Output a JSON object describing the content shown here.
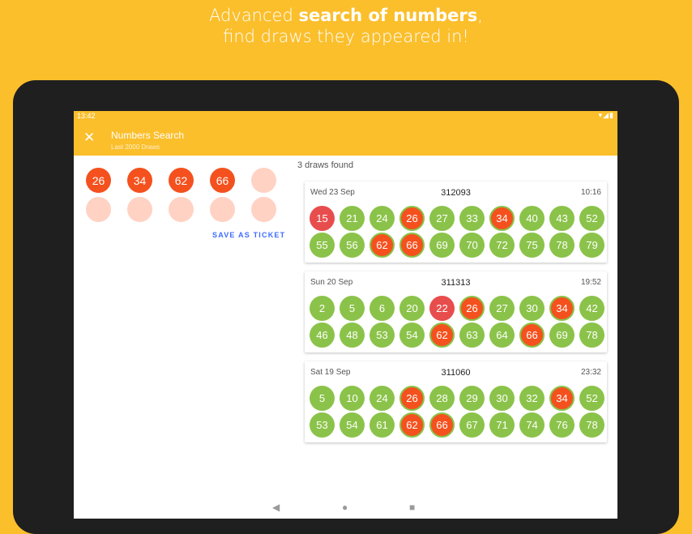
{
  "promo": {
    "line1_prefix": "Advanced ",
    "line1_bold": "search of numbers",
    "line1_suffix": ",",
    "line2": "find draws they appeared in!"
  },
  "status_bar": {
    "time": "13:42",
    "icons": "wifi-icon signal-icon battery-icon"
  },
  "app_bar": {
    "title": "Numbers Search",
    "subtitle": "Last 2000 Draws",
    "close_icon": "close-icon"
  },
  "selection": {
    "numbers": [
      "26",
      "34",
      "62",
      "66"
    ],
    "empty_slots": 6,
    "save_label": "SAVE AS TICKET"
  },
  "results": {
    "found_label": "3 draws found",
    "draws": [
      {
        "date": "Wed 23 Sep",
        "number": "312093",
        "time": "10:16",
        "rows": [
          [
            [
              "15",
              "red"
            ],
            [
              "21",
              "green"
            ],
            [
              "24",
              "green"
            ],
            [
              "26",
              "match"
            ],
            [
              "27",
              "green"
            ],
            [
              "33",
              "green"
            ],
            [
              "34",
              "match"
            ],
            [
              "40",
              "green"
            ],
            [
              "43",
              "green"
            ],
            [
              "52",
              "green"
            ]
          ],
          [
            [
              "55",
              "green"
            ],
            [
              "56",
              "green"
            ],
            [
              "62",
              "match"
            ],
            [
              "66",
              "match"
            ],
            [
              "69",
              "green"
            ],
            [
              "70",
              "green"
            ],
            [
              "72",
              "green"
            ],
            [
              "75",
              "green"
            ],
            [
              "78",
              "green"
            ],
            [
              "79",
              "green"
            ]
          ]
        ]
      },
      {
        "date": "Sun 20 Sep",
        "number": "311313",
        "time": "19:52",
        "rows": [
          [
            [
              "2",
              "green"
            ],
            [
              "5",
              "green"
            ],
            [
              "6",
              "green"
            ],
            [
              "20",
              "green"
            ],
            [
              "22",
              "red"
            ],
            [
              "26",
              "match"
            ],
            [
              "27",
              "green"
            ],
            [
              "30",
              "green"
            ],
            [
              "34",
              "match"
            ],
            [
              "42",
              "green"
            ]
          ],
          [
            [
              "46",
              "green"
            ],
            [
              "48",
              "green"
            ],
            [
              "53",
              "green"
            ],
            [
              "54",
              "green"
            ],
            [
              "62",
              "match"
            ],
            [
              "63",
              "green"
            ],
            [
              "64",
              "green"
            ],
            [
              "66",
              "match"
            ],
            [
              "69",
              "green"
            ],
            [
              "78",
              "green"
            ]
          ]
        ]
      },
      {
        "date": "Sat 19 Sep",
        "number": "311060",
        "time": "23:32",
        "rows": [
          [
            [
              "5",
              "green"
            ],
            [
              "10",
              "green"
            ],
            [
              "24",
              "green"
            ],
            [
              "26",
              "match"
            ],
            [
              "28",
              "green"
            ],
            [
              "29",
              "green"
            ],
            [
              "30",
              "green"
            ],
            [
              "32",
              "green"
            ],
            [
              "34",
              "match"
            ],
            [
              "52",
              "green"
            ]
          ],
          [
            [
              "53",
              "green"
            ],
            [
              "54",
              "green"
            ],
            [
              "61",
              "green"
            ],
            [
              "62",
              "match"
            ],
            [
              "66",
              "match"
            ],
            [
              "67",
              "green"
            ],
            [
              "71",
              "green"
            ],
            [
              "74",
              "green"
            ],
            [
              "76",
              "green"
            ],
            [
              "78",
              "green"
            ]
          ]
        ]
      }
    ]
  },
  "colors": {
    "brand": "#FBBF2C",
    "ball_green": "#8BC34A",
    "ball_match": "#F4511E",
    "ball_red": "#E84D4D",
    "link": "#3D6BFF"
  },
  "nav": {
    "back": "◀",
    "home": "●",
    "recents": "■"
  }
}
